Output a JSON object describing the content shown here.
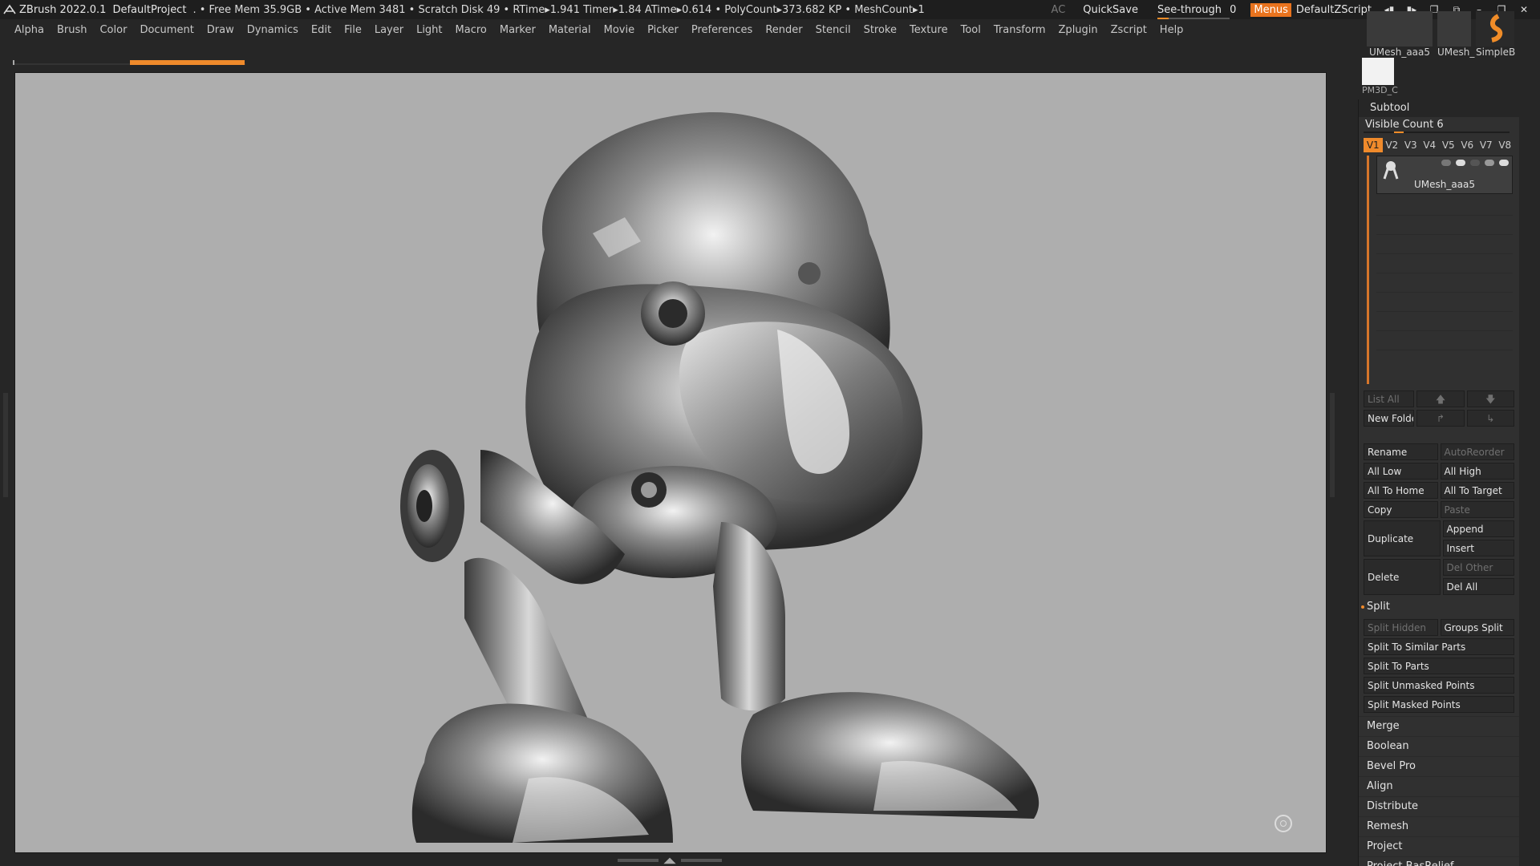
{
  "titlebar": {
    "app_version": "ZBrush 2022.0.1",
    "project": "DefaultProject",
    "stats": ". • Free Mem 35.9GB • Active Mem 3481 • Scratch Disk 49 • RTime▸1.941 Timer▸1.84 ATime▸0.614 • PolyCount▸373.682 KP • MeshCount▸1",
    "ac": "AC",
    "quicksave": "QuickSave",
    "see_through_label": "See-through",
    "see_through_value": "0",
    "see_through_level": 0.15,
    "menus": "Menus",
    "default_zscript": "DefaultZScript"
  },
  "menubar": {
    "items": [
      "Alpha",
      "Brush",
      "Color",
      "Document",
      "Draw",
      "Dynamics",
      "Edit",
      "File",
      "Layer",
      "Light",
      "Macro",
      "Marker",
      "Material",
      "Movie",
      "Picker",
      "Preferences",
      "Render",
      "Stencil",
      "Stroke",
      "Texture",
      "Tool",
      "Transform",
      "Zplugin",
      "Zscript",
      "Help"
    ]
  },
  "tool_thumbs": {
    "t1": "UMesh_aaa5",
    "t2": "UMesh_",
    "t3": "SimpleB",
    "t4": "PM3D_C"
  },
  "subtool": {
    "title": "Subtool",
    "visible_count": "Visible Count 6",
    "versions": [
      "V1",
      "V2",
      "V3",
      "V4",
      "V5",
      "V6",
      "V7",
      "V8"
    ],
    "active_version": "V1",
    "item_name": "UMesh_aaa5"
  },
  "buttons": {
    "list_all": "List All",
    "new_folder": "New Folder",
    "rename": "Rename",
    "autoreorder": "AutoReorder",
    "all_low": "All Low",
    "all_high": "All High",
    "all_to_home": "All To Home",
    "all_to_target": "All To Target",
    "copy": "Copy",
    "paste": "Paste",
    "duplicate": "Duplicate",
    "append": "Append",
    "insert": "Insert",
    "delete": "Delete",
    "del_other": "Del Other",
    "del_all": "Del All"
  },
  "split": {
    "title": "Split",
    "split_hidden": "Split Hidden",
    "groups_split": "Groups Split",
    "split_similar": "Split To Similar Parts",
    "split_parts": "Split To Parts",
    "split_unmasked": "Split Unmasked Points",
    "split_masked": "Split Masked Points"
  },
  "sections": [
    "Merge",
    "Boolean",
    "Bevel Pro",
    "Align",
    "Distribute",
    "Remesh",
    "Project",
    "Project BasRelief"
  ],
  "colors": {
    "accent": "#ef8a2b",
    "canvas_bg": "#aeaeae",
    "panel_bg": "#303030"
  }
}
